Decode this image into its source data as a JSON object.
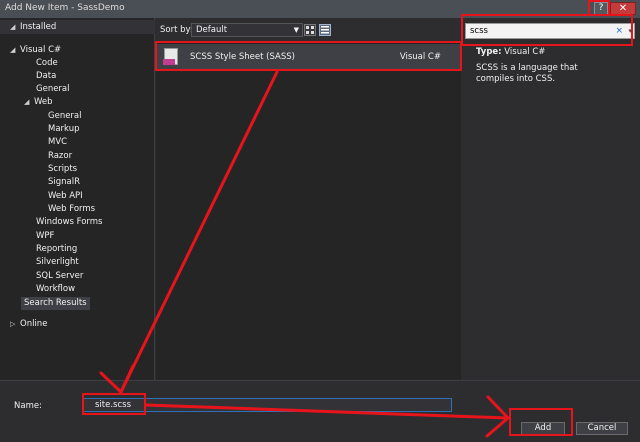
{
  "window": {
    "title": "Add New Item - SassDemo",
    "help_label": "?",
    "close_label": "✕"
  },
  "tree": {
    "installed_label": "Installed",
    "items": [
      {
        "label": "Visual C#",
        "arrow": "◢"
      },
      {
        "label": "Code"
      },
      {
        "label": "Data"
      },
      {
        "label": "General"
      },
      {
        "label": "Web",
        "arrow": "◢"
      },
      {
        "label": "General"
      },
      {
        "label": "Markup"
      },
      {
        "label": "MVC"
      },
      {
        "label": "Razor"
      },
      {
        "label": "Scripts"
      },
      {
        "label": "SignalR"
      },
      {
        "label": "Web API"
      },
      {
        "label": "Web Forms"
      },
      {
        "label": "Windows Forms"
      },
      {
        "label": "WPF"
      },
      {
        "label": "Reporting"
      },
      {
        "label": "Silverlight"
      },
      {
        "label": "SQL Server"
      },
      {
        "label": "Workflow"
      },
      {
        "label": "Search Results"
      }
    ],
    "online_label": "Online"
  },
  "toolbar": {
    "sort_label": "Sort by:",
    "sort_value": "Default"
  },
  "templates": [
    {
      "name": "SCSS Style Sheet (SASS)",
      "language": "Visual C#",
      "icon": "scss-file-icon"
    }
  ],
  "search": {
    "value": "scss",
    "clear_icon": "×",
    "dropdown_icon": "▾"
  },
  "details": {
    "type_label": "Type:",
    "type_value": "Visual C#",
    "description": "SCSS is a language that compiles into CSS."
  },
  "bottom": {
    "name_label": "Name:",
    "name_value": "site.scss",
    "add_label": "Add",
    "cancel_label": "Cancel"
  },
  "colors": {
    "annotation": "#e8141c",
    "accent": "#2f70b8",
    "tag": "#c13d91"
  }
}
